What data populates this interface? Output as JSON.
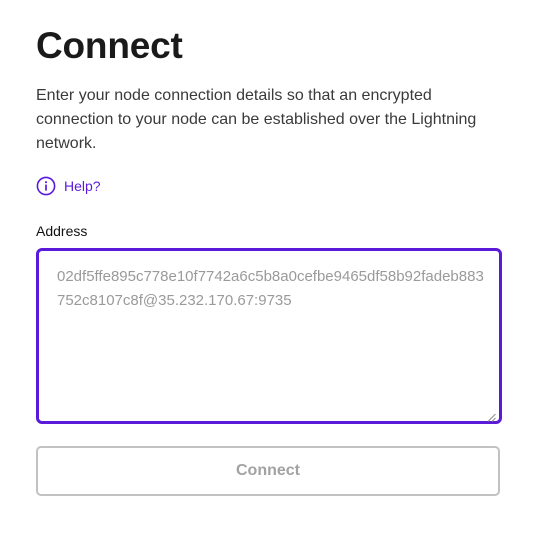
{
  "page": {
    "title": "Connect",
    "description": "Enter your node connection details so that an encrypted connection to your node can be established over the Lightning network."
  },
  "help": {
    "label": "Help?",
    "icon": "info-circle-icon",
    "color": "#5b1ad9"
  },
  "address": {
    "label": "Address",
    "placeholder": "02df5ffe895c778e10f7742a6c5b8a0cefbe9465df58b92fadeb883752c8107c8f@35.232.170.67:9735",
    "focus_color": "#5b1ad9"
  },
  "connect_button": {
    "label": "Connect",
    "state": "disabled"
  }
}
